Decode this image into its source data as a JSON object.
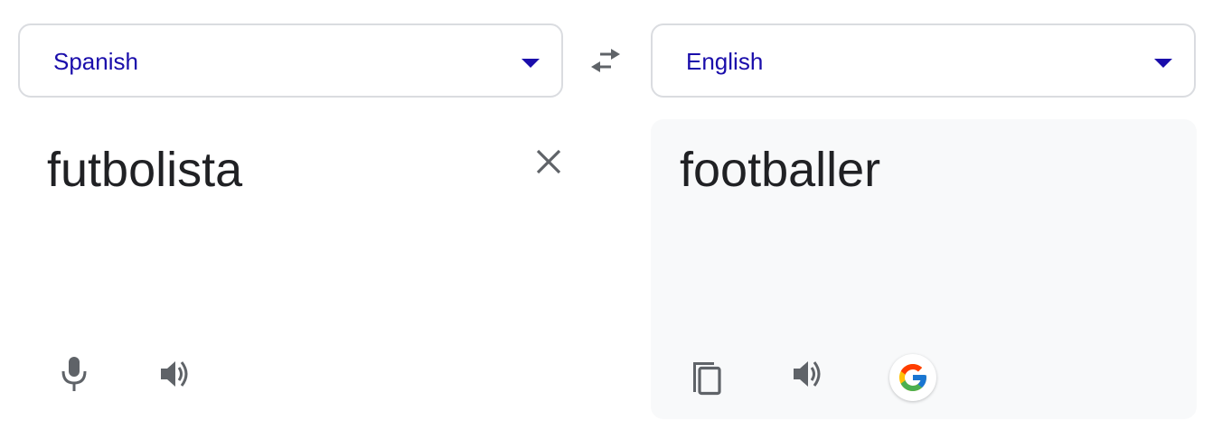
{
  "source_language": {
    "label": "Spanish"
  },
  "target_language": {
    "label": "English"
  },
  "source_input": {
    "text": "futbolista"
  },
  "translation": {
    "text": "footballer"
  },
  "colors": {
    "language_label": "#1a0dab",
    "icon": "#5f6368",
    "text": "#202124",
    "panel_background": "#f8f9fa"
  },
  "icons": {
    "swap": "swap-arrows-icon",
    "clear": "close-icon",
    "microphone": "microphone-icon",
    "source_listen": "speaker-icon",
    "copy": "copy-icon",
    "target_listen": "speaker-icon",
    "google": "google-logo-icon"
  }
}
